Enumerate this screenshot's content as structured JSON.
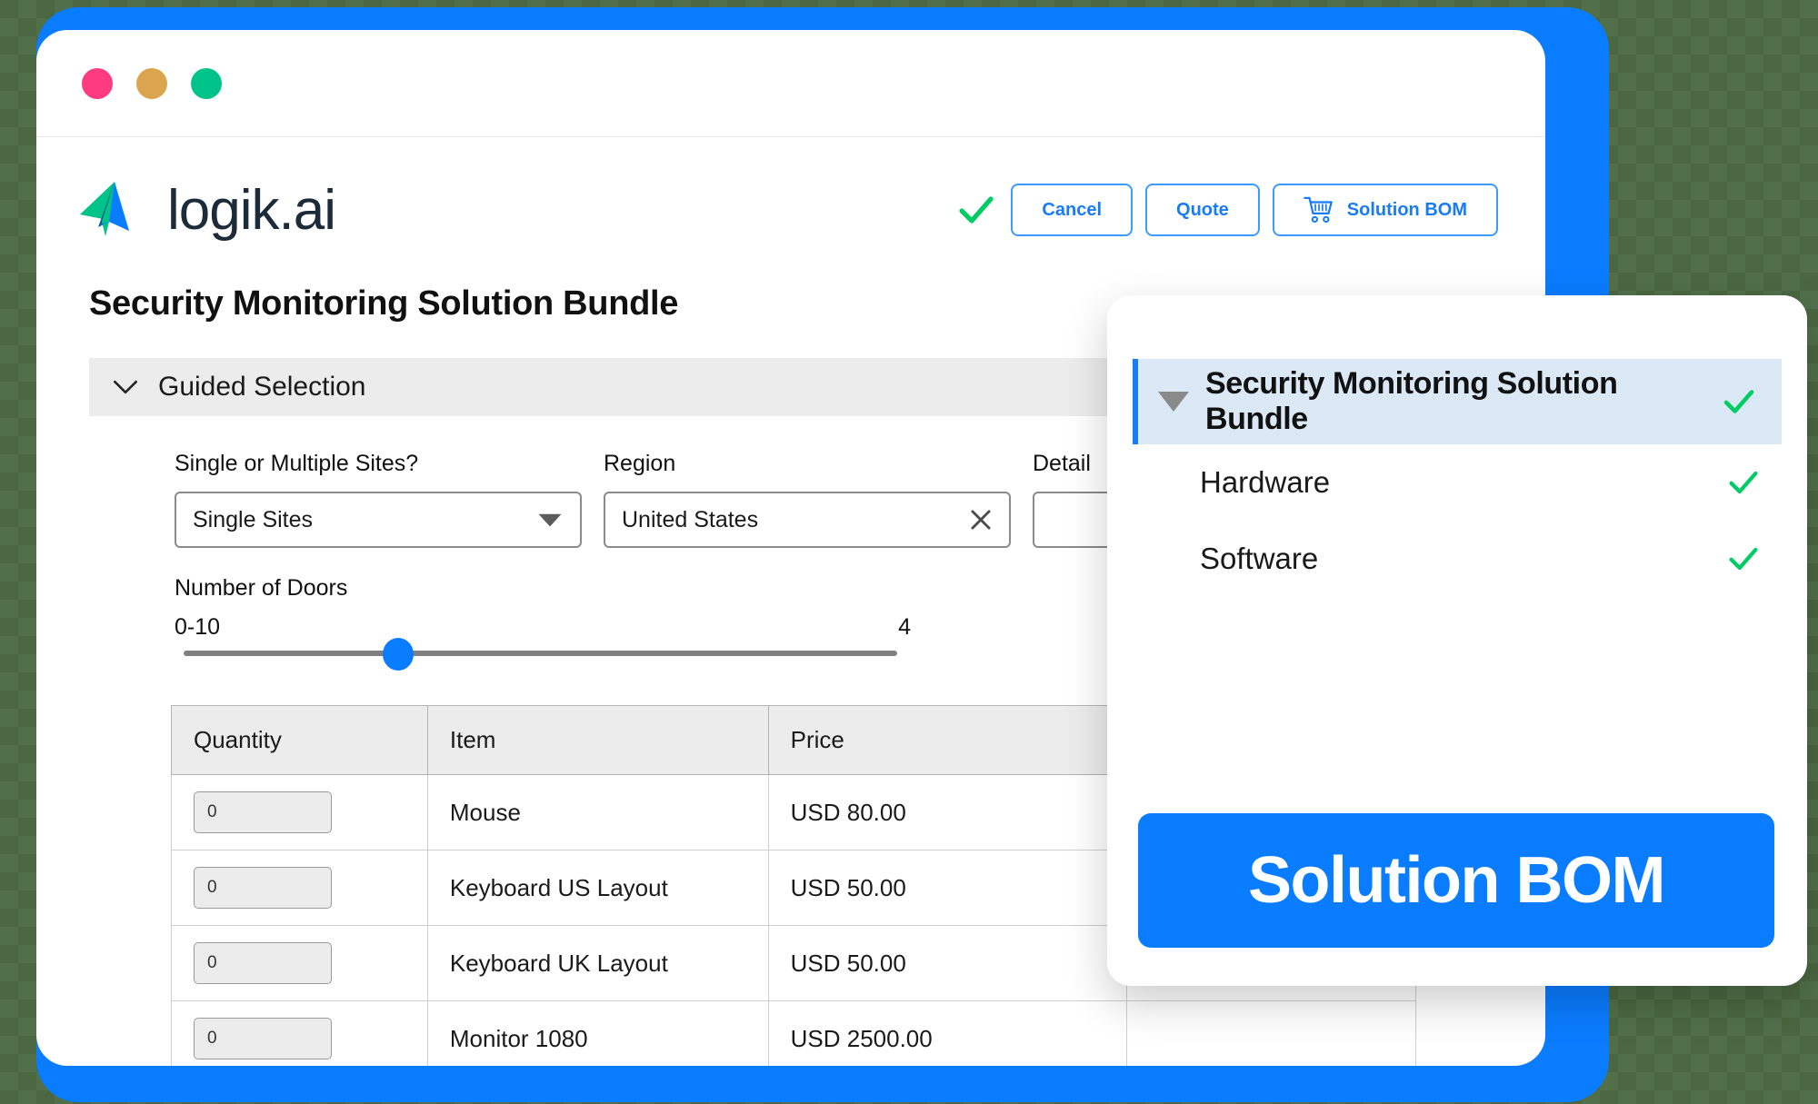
{
  "window": {
    "dots": [
      {
        "name": "close",
        "color": "#ff3b7f"
      },
      {
        "name": "minimize",
        "color": "#dba44e"
      },
      {
        "name": "maximize",
        "color": "#00c389"
      }
    ]
  },
  "brand": {
    "name": "logik.ai"
  },
  "header": {
    "status_icon": "check-icon",
    "buttons": [
      {
        "label": "Cancel",
        "icon": null
      },
      {
        "label": "Quote",
        "icon": null
      },
      {
        "label": "Solution BOM",
        "icon": "cart-icon"
      }
    ]
  },
  "page": {
    "title": "Security Monitoring Solution Bundle"
  },
  "guided_selection": {
    "label": "Guided Selection",
    "chevron": "chevron-down-icon"
  },
  "form": {
    "fields": [
      {
        "label": "Single or Multiple Sites?",
        "value": "Single Sites",
        "control": "dropdown",
        "icon": "caret-down-icon"
      },
      {
        "label": "Region",
        "value": "United States",
        "control": "combobox",
        "icon": "clear-x-icon"
      },
      {
        "label": "Detail",
        "value": "",
        "control": "text",
        "icon": null
      }
    ],
    "slider": {
      "label": "Number of Doors",
      "range_label": "0-10",
      "value": "4",
      "min": 0,
      "max": 10,
      "position_pct": 30
    }
  },
  "table": {
    "columns": [
      "Quantity",
      "Item",
      "Price",
      ""
    ],
    "rows": [
      {
        "quantity": "0",
        "item": "Mouse",
        "price": "USD 80.00",
        "extra": ""
      },
      {
        "quantity": "0",
        "item": "Keyboard US Layout",
        "price": "USD 50.00",
        "extra": ""
      },
      {
        "quantity": "0",
        "item": "Keyboard UK Layout",
        "price": "USD 50.00",
        "extra": ""
      },
      {
        "quantity": "0",
        "item": "Monitor 1080",
        "price": "USD 2500.00",
        "extra": ""
      }
    ]
  },
  "bom_panel": {
    "root": {
      "label": "Security Monitoring Solution Bundle",
      "expanded": true,
      "status_icon": "check-icon"
    },
    "children": [
      {
        "label": "Hardware",
        "status_icon": "check-icon"
      },
      {
        "label": "Software",
        "status_icon": "check-icon"
      }
    ],
    "cta_label": "Solution BOM"
  },
  "colors": {
    "accent_blue": "#0a7cff",
    "button_blue": "#1a7cf5",
    "check_green": "#00cc66",
    "highlight_row": "#dbe9f7",
    "header_gray": "#ececec",
    "logo_green": "#00c389",
    "logo_dark": "#0d5c8c",
    "logo_blue": "#0a7cff"
  }
}
